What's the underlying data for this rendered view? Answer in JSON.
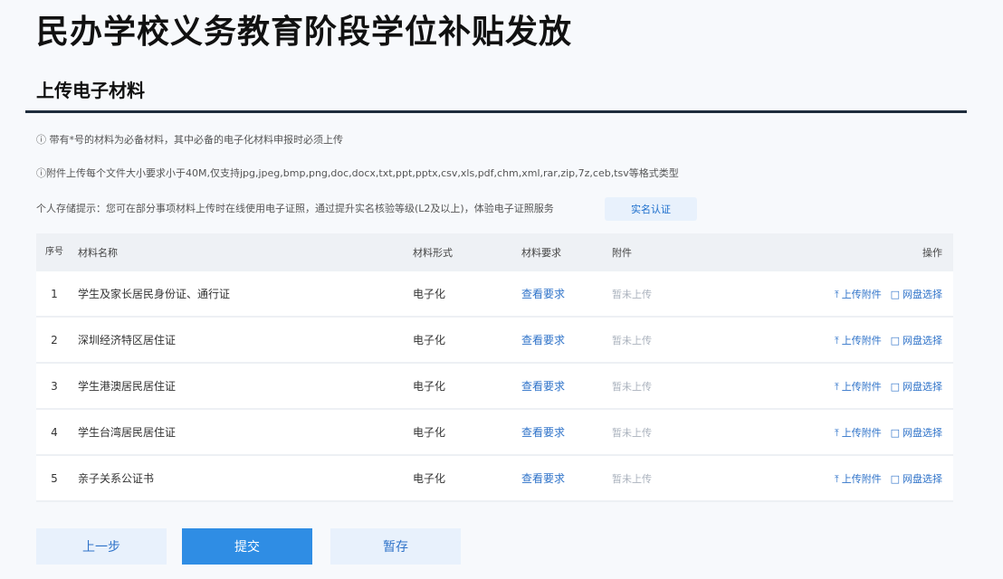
{
  "page": {
    "title": "民办学校义务教育阶段学位补贴发放",
    "subtitle": "上传电子材料"
  },
  "notes": {
    "note1": "ⓘ 带有*号的材料为必备材料，其中必备的电子化材料申报时必须上传",
    "note2": "ⓘ附件上传每个文件大小要求小于40M,仅支持jpg,jpeg,bmp,png,doc,docx,txt,ppt,pptx,csv,xls,pdf,chm,xml,rar,zip,7z,ceb,tsv等格式类型",
    "note3": "个人存储提示：您可在部分事项材料上传时在线使用电子证照，通过提升实名核验等级(L2及以上)，体验电子证照服务",
    "cert_button": "实名认证"
  },
  "table": {
    "headers": {
      "no": "序号",
      "name": "材料名称",
      "form": "材料形式",
      "req": "材料要求",
      "att": "附件",
      "op": "操作"
    },
    "rows": [
      {
        "no": "1",
        "name": "学生及家长居民身份证、通行证",
        "form": "电子化",
        "req": "查看要求",
        "att": "暂未上传",
        "upload": "上传附件",
        "select": "网盘选择"
      },
      {
        "no": "2",
        "name": "深圳经济特区居住证",
        "form": "电子化",
        "req": "查看要求",
        "att": "暂未上传",
        "upload": "上传附件",
        "select": "网盘选择"
      },
      {
        "no": "3",
        "name": "学生港澳居民居住证",
        "form": "电子化",
        "req": "查看要求",
        "att": "暂未上传",
        "upload": "上传附件",
        "select": "网盘选择"
      },
      {
        "no": "4",
        "name": "学生台湾居民居住证",
        "form": "电子化",
        "req": "查看要求",
        "att": "暂未上传",
        "upload": "上传附件",
        "select": "网盘选择"
      },
      {
        "no": "5",
        "name": "亲子关系公证书",
        "form": "电子化",
        "req": "查看要求",
        "att": "暂未上传",
        "upload": "上传附件",
        "select": "网盘选择"
      }
    ]
  },
  "icons": {
    "upload": "upload-icon",
    "folder": "folder-icon"
  },
  "buttons": {
    "prev": "上一步",
    "submit": "提交",
    "save": "暂存"
  },
  "colors": {
    "accent": "#2f8de4",
    "link": "#2f73c9",
    "header_bg": "#eef1f5"
  }
}
